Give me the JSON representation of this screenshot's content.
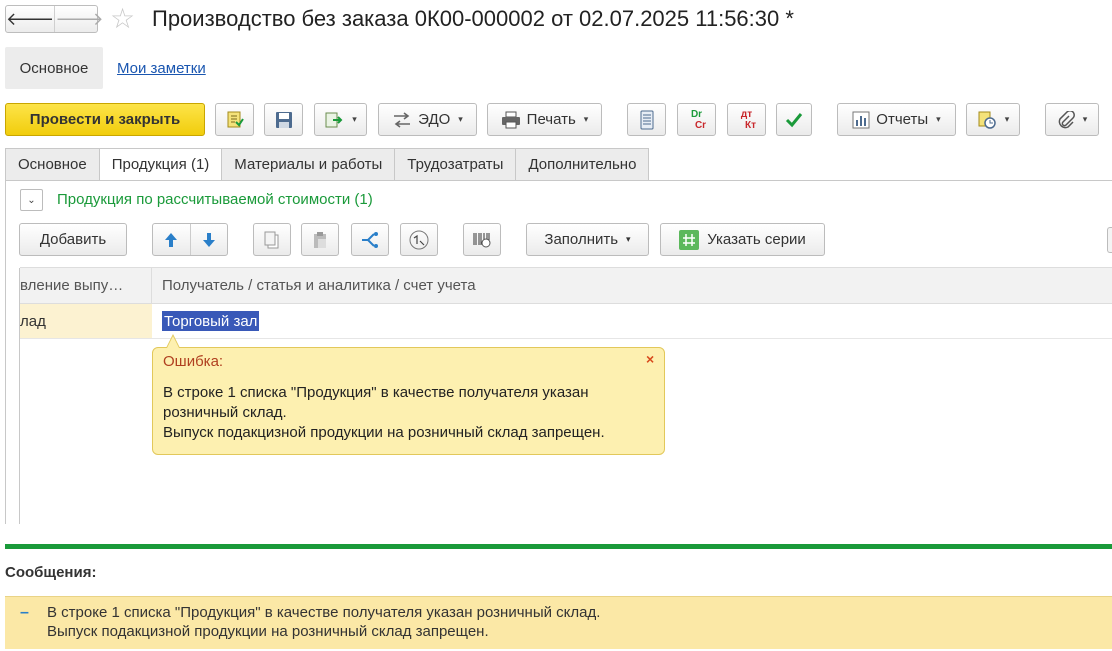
{
  "window": {
    "title": "Производство без заказа 0К00-000002 от 02.07.2025 11:56:30 *",
    "back_glyph": "🡐",
    "forward_glyph": "🡒",
    "star_glyph": "☆"
  },
  "sections": {
    "main": "Основное",
    "notes": "Мои заметки"
  },
  "toolbar": {
    "post_close": "Провести и закрыть",
    "edo": "ЭДО",
    "print": "Печать",
    "reports": "Отчеты",
    "drcr_top": "Dr",
    "drcr_bottom": "Cr",
    "dtkt_top": "дт",
    "dtkt_bottom": "Кт",
    "dropdown_glyph": "▾"
  },
  "tabs": [
    {
      "label": "Основное",
      "active": false
    },
    {
      "label": "Продукция (1)",
      "active": true
    },
    {
      "label": "Материалы и работы",
      "active": false
    },
    {
      "label": "Трудозатраты",
      "active": false
    },
    {
      "label": "Дополнительно",
      "active": false
    }
  ],
  "group": {
    "toggle_glyph": "⌄",
    "title": "Продукция по рассчитываемой стоимости (1)"
  },
  "table_toolbar": {
    "add": "Добавить",
    "fill": "Заполнить",
    "series": "Указать серии"
  },
  "table": {
    "headers": [
      "вление выпу…",
      "Получатель / статья и аналитика / счет учета"
    ],
    "rows": [
      {
        "col1": "лад",
        "col2": "Торговый зал"
      }
    ]
  },
  "error_popup": {
    "title": "Ошибка:",
    "close_glyph": "×",
    "lines": [
      "В строке 1 списка \"Продукция\" в качестве получателя указан",
      "розничный склад.",
      "Выпуск подакцизной продукции на розничный склад запрещен."
    ]
  },
  "messages": {
    "title": "Сообщения:",
    "dash": "–",
    "lines": [
      "В строке 1 списка \"Продукция\" в качестве получателя указан розничный склад.",
      "Выпуск подакцизной продукции на розничный склад запрещен."
    ]
  },
  "colors": {
    "accent_yellow": "#f5d327",
    "group_green": "#1a9a3a",
    "selection_blue": "#3959b8",
    "error_bg": "#fdf0b0",
    "message_bg": "#fbe8a6"
  }
}
